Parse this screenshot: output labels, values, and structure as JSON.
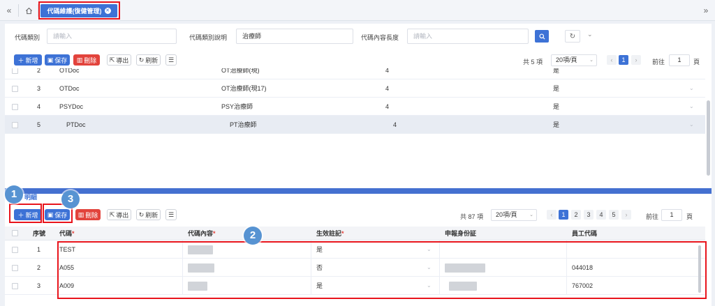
{
  "topbar": {
    "collapse_left_glyph": "«",
    "home_icon": "home-icon",
    "active_tab": "代碼維護(復健管理)",
    "collapse_right_glyph": "»"
  },
  "filter": {
    "label1": "代碼類別",
    "input1_placeholder": "請輸入",
    "label2": "代碼類別說明",
    "input2_value": "治療師",
    "label3": "代碼內容長度",
    "input3_placeholder": "請輸入"
  },
  "toolbar": {
    "add": "新增",
    "save": "保存",
    "delete": "刪除",
    "export": "導出",
    "refresh": "刷新"
  },
  "master_pager": {
    "total": "共 5 項",
    "page_size": "20項/頁",
    "pages": [
      "1"
    ],
    "goto_label": "前往",
    "goto_value": "1",
    "page_unit": "頁"
  },
  "master_rows": [
    {
      "no": "2",
      "code": "OTDoc",
      "desc": "OT治療師(現)",
      "len": "4",
      "flag": "是"
    },
    {
      "no": "3",
      "code": "OTDoc",
      "desc": "OT治療師(現17)",
      "len": "4",
      "flag": "是"
    },
    {
      "no": "4",
      "code": "PSYDoc",
      "desc": "PSY治療師",
      "len": "4",
      "flag": "是"
    },
    {
      "no": "5",
      "code": "PTDoc",
      "desc": "PT治療師",
      "len": "4",
      "flag": "是"
    }
  ],
  "detail": {
    "tab_label": "明細",
    "pager": {
      "total": "共 87 項",
      "page_size": "20項/頁",
      "pages": [
        "1",
        "2",
        "3",
        "4",
        "5"
      ],
      "goto_label": "前往",
      "goto_value": "1",
      "page_unit": "頁"
    },
    "headers": {
      "seq": "序號",
      "code": "代碼",
      "content": "代碼內容",
      "effective": "生效註記",
      "id": "申報身份証",
      "emp": "員工代碼",
      "required_mark": "*"
    },
    "rows": [
      {
        "seq": "1",
        "code": "TEST",
        "effective": "是",
        "emp": ""
      },
      {
        "seq": "2",
        "code": "A055",
        "effective": "否",
        "emp": "044018"
      },
      {
        "seq": "3",
        "code": "A009",
        "effective": "是",
        "emp": "767002"
      }
    ]
  },
  "annotations": {
    "badge1": "1",
    "badge2": "2",
    "badge3": "3"
  },
  "colors": {
    "accent": "#3d72d6",
    "danger": "#e2433c",
    "highlight_box": "#e8141c",
    "badge": "#5793d2"
  }
}
